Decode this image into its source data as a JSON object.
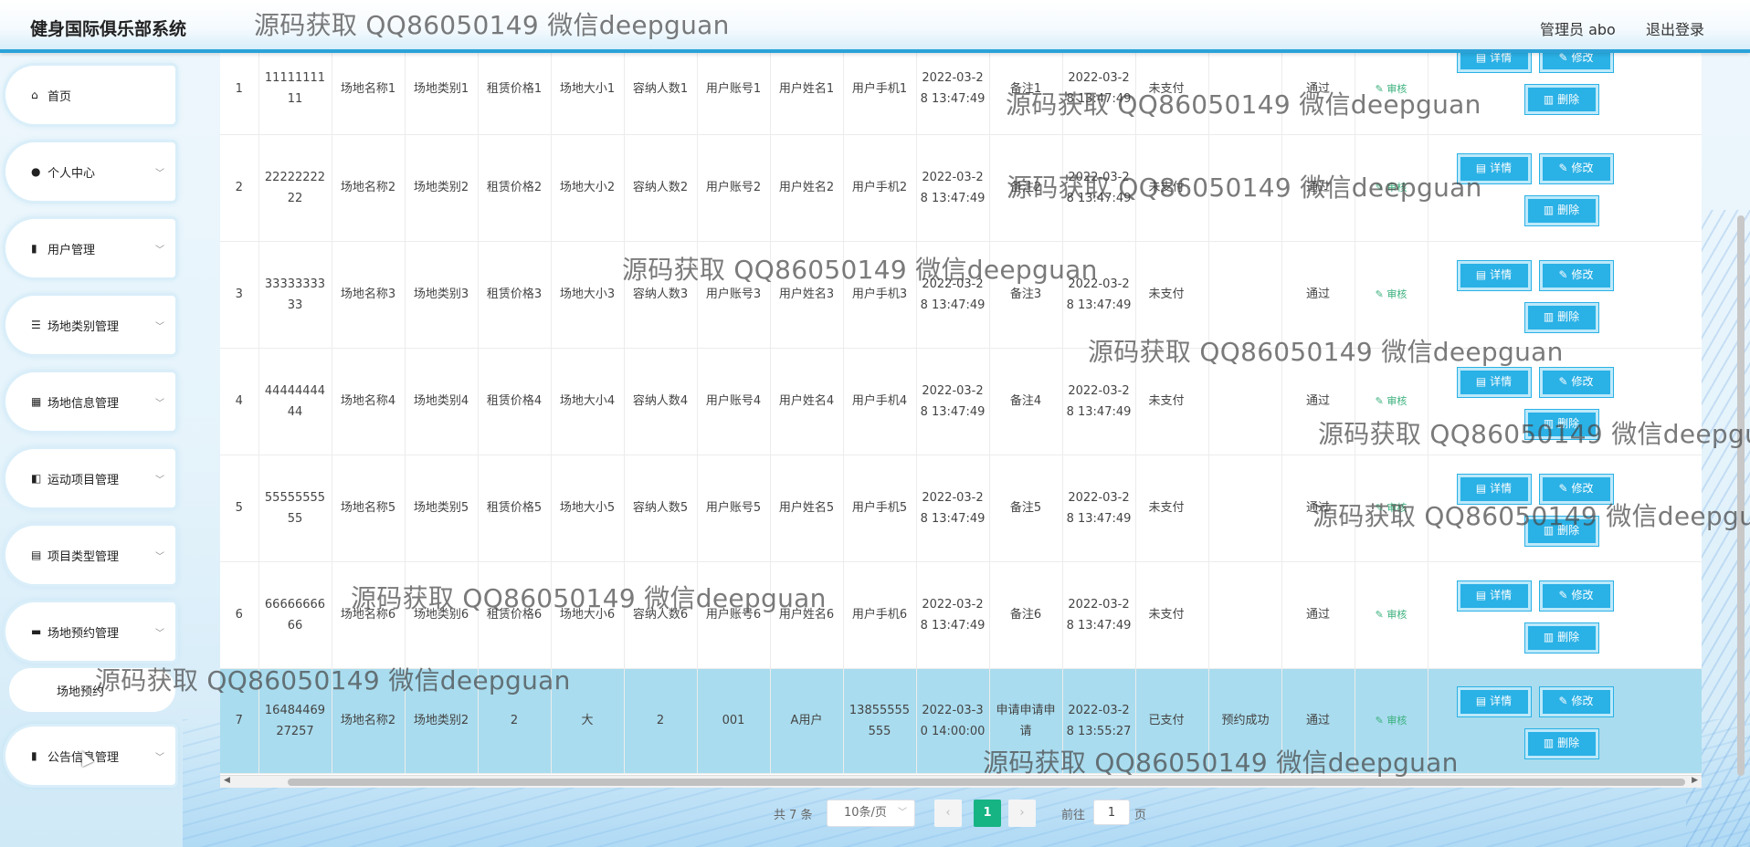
{
  "header": {
    "title": "健身国际俱乐部系统",
    "admin": "管理员 abo",
    "logout": "退出登录"
  },
  "sidebar": {
    "items": [
      {
        "label": "首页",
        "icon": "home-icon",
        "glyph": "⌂",
        "chevron": false
      },
      {
        "label": "个人中心",
        "icon": "user-icon",
        "glyph": "●",
        "chevron": true
      },
      {
        "label": "用户管理",
        "icon": "user-manage-icon",
        "glyph": "▮",
        "chevron": true
      },
      {
        "label": "场地类别管理",
        "icon": "list-icon",
        "glyph": "☰",
        "chevron": true
      },
      {
        "label": "场地信息管理",
        "icon": "grid-icon",
        "glyph": "▦",
        "chevron": true
      },
      {
        "label": "运动项目管理",
        "icon": "sport-icon",
        "glyph": "◧",
        "chevron": true
      },
      {
        "label": "项目类型管理",
        "icon": "doc-icon",
        "glyph": "▤",
        "chevron": true
      },
      {
        "label": "场地预约管理",
        "icon": "briefcase-icon",
        "glyph": "▬",
        "chevron": true
      },
      {
        "label": "公告信息管理",
        "icon": "notice-icon",
        "glyph": "▮",
        "chevron": true
      }
    ],
    "submenu": "场地预约"
  },
  "table": {
    "rows": [
      {
        "idx": "1",
        "no": "1111111111",
        "venue_name": "场地名称1",
        "venue_type": "场地类别1",
        "price": "租赁价格1",
        "size": "场地大小1",
        "capacity": "容纳人数1",
        "account": "用户账号1",
        "user_name": "用户姓名1",
        "phone": "用户手机1",
        "apply_time": "2022-03-28 13:47:49",
        "remark": "备注1",
        "create_time": "2022-03-28 13:47:49",
        "pay": "未支付",
        "reply": "",
        "status": "通过"
      },
      {
        "idx": "2",
        "no": "2222222222",
        "venue_name": "场地名称2",
        "venue_type": "场地类别2",
        "price": "租赁价格2",
        "size": "场地大小2",
        "capacity": "容纳人数2",
        "account": "用户账号2",
        "user_name": "用户姓名2",
        "phone": "用户手机2",
        "apply_time": "2022-03-28 13:47:49",
        "remark": "备注2",
        "create_time": "2022-03-28 13:47:49",
        "pay": "未支付",
        "reply": "",
        "status": "通过"
      },
      {
        "idx": "3",
        "no": "3333333333",
        "venue_name": "场地名称3",
        "venue_type": "场地类别3",
        "price": "租赁价格3",
        "size": "场地大小3",
        "capacity": "容纳人数3",
        "account": "用户账号3",
        "user_name": "用户姓名3",
        "phone": "用户手机3",
        "apply_time": "2022-03-28 13:47:49",
        "remark": "备注3",
        "create_time": "2022-03-28 13:47:49",
        "pay": "未支付",
        "reply": "",
        "status": "通过"
      },
      {
        "idx": "4",
        "no": "4444444444",
        "venue_name": "场地名称4",
        "venue_type": "场地类别4",
        "price": "租赁价格4",
        "size": "场地大小4",
        "capacity": "容纳人数4",
        "account": "用户账号4",
        "user_name": "用户姓名4",
        "phone": "用户手机4",
        "apply_time": "2022-03-28 13:47:49",
        "remark": "备注4",
        "create_time": "2022-03-28 13:47:49",
        "pay": "未支付",
        "reply": "",
        "status": "通过"
      },
      {
        "idx": "5",
        "no": "5555555555",
        "venue_name": "场地名称5",
        "venue_type": "场地类别5",
        "price": "租赁价格5",
        "size": "场地大小5",
        "capacity": "容纳人数5",
        "account": "用户账号5",
        "user_name": "用户姓名5",
        "phone": "用户手机5",
        "apply_time": "2022-03-28 13:47:49",
        "remark": "备注5",
        "create_time": "2022-03-28 13:47:49",
        "pay": "未支付",
        "reply": "",
        "status": "通过"
      },
      {
        "idx": "6",
        "no": "6666666666",
        "venue_name": "场地名称6",
        "venue_type": "场地类别6",
        "price": "租赁价格6",
        "size": "场地大小6",
        "capacity": "容纳人数6",
        "account": "用户账号6",
        "user_name": "用户姓名6",
        "phone": "用户手机6",
        "apply_time": "2022-03-28 13:47:49",
        "remark": "备注6",
        "create_time": "2022-03-28 13:47:49",
        "pay": "未支付",
        "reply": "",
        "status": "通过"
      },
      {
        "idx": "7",
        "no": "1648446927257",
        "venue_name": "场地名称2",
        "venue_type": "场地类别2",
        "price": "2",
        "size": "大",
        "capacity": "2",
        "account": "001",
        "user_name": "A用户",
        "phone": "13855555555",
        "apply_time": "2022-03-30 14:00:00",
        "remark": "申请申请申请",
        "create_time": "2022-03-28 13:55:27",
        "pay": "已支付",
        "reply": "预约成功",
        "status": "通过"
      }
    ],
    "audit_label": "审核",
    "detail_label": "详情",
    "edit_label": "修改",
    "delete_label": "删除",
    "audit_icon": "edit-icon",
    "detail_icon": "doc-icon",
    "delete_icon": "trash-icon"
  },
  "pagination": {
    "total": "共 7 条",
    "page_size": "10条/页",
    "prev": "‹",
    "current": "1",
    "next": "›",
    "goto_label": "前往",
    "goto_value": "1",
    "goto_suffix": "页"
  },
  "watermark": "源码获取 QQ86050149 微信deepguan",
  "colors": {
    "accent": "#2ab1e6",
    "header_border": "#2aa2d8",
    "selected_row": "#a9dcee",
    "page_active": "#16b383",
    "audit": "#3ab07c"
  }
}
